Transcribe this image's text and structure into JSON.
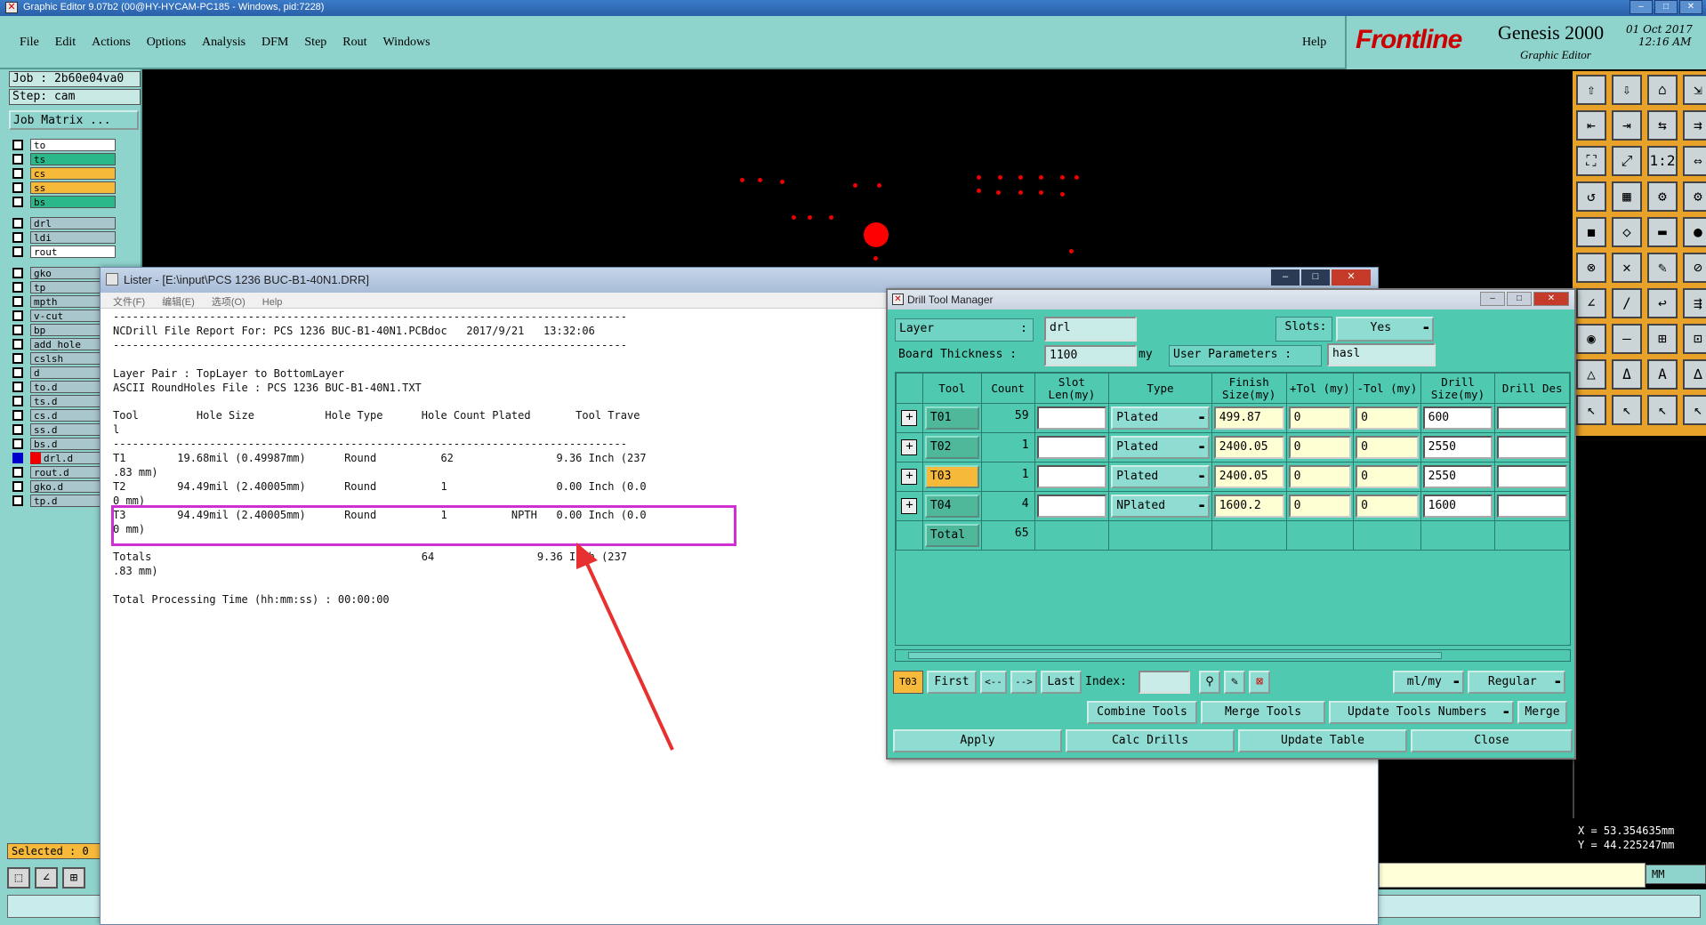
{
  "window": {
    "title": "Graphic Editor 9.07b2 (00@HY-HYCAM-PC185 - Windows, pid:7228)"
  },
  "menu": {
    "items": [
      "File",
      "Edit",
      "Actions",
      "Options",
      "Analysis",
      "DFM",
      "Step",
      "Rout",
      "Windows"
    ],
    "help": "Help"
  },
  "brand": {
    "logo": "Frontline",
    "title": "Genesis 2000",
    "subtitle": "Graphic Editor",
    "date": "01 Oct 2017",
    "time": "12:16 AM"
  },
  "left": {
    "job": "Job : 2b60e04va0",
    "step": "Step: cam",
    "job_matrix": "Job Matrix ...",
    "selected": "Selected : 0",
    "layers_a": [
      {
        "name": "to",
        "color": "#ffffff"
      },
      {
        "name": "ts",
        "color": "#2ab88a"
      },
      {
        "name": "cs",
        "color": "#f7b93a"
      },
      {
        "name": "ss",
        "color": "#f7b93a"
      },
      {
        "name": "bs",
        "color": "#2ab88a"
      }
    ],
    "layers_b": [
      {
        "name": "drl",
        "color": "#a9c6cc"
      },
      {
        "name": "ldi",
        "color": "#a9c6cc"
      },
      {
        "name": "rout",
        "color": "#ffffff"
      }
    ],
    "layers_c": [
      {
        "name": "gko",
        "color": "#a9c6cc"
      },
      {
        "name": "tp",
        "color": "#a9c6cc"
      },
      {
        "name": "mpth",
        "color": "#a9c6cc"
      },
      {
        "name": "v-cut",
        "color": "#a9c6cc"
      },
      {
        "name": "bp",
        "color": "#a9c6cc"
      },
      {
        "name": "add_hole",
        "color": "#a9c6cc"
      },
      {
        "name": "cslsh",
        "color": "#a9c6cc"
      },
      {
        "name": "d",
        "color": "#a9c6cc"
      },
      {
        "name": "to.d",
        "color": "#a9c6cc"
      },
      {
        "name": "ts.d",
        "color": "#a9c6cc"
      },
      {
        "name": "cs.d",
        "color": "#a9c6cc"
      },
      {
        "name": "ss.d",
        "color": "#a9c6cc"
      },
      {
        "name": "bs.d",
        "color": "#a9c6cc"
      },
      {
        "name": "drl.d",
        "color": "#a9c6cc",
        "selected": true
      },
      {
        "name": "rout.d",
        "color": "#a9c6cc"
      },
      {
        "name": "gko.d",
        "color": "#a9c6cc"
      },
      {
        "name": "tp.d",
        "color": "#a9c6cc"
      }
    ]
  },
  "lister": {
    "title": "Lister - [E:\\input\\PCS 1236 BUC-B1-40N1.DRR]",
    "menu": [
      "文件(F)",
      "编辑(E)",
      "选项(O)",
      "Help"
    ],
    "lines": [
      "--------------------------------------------------------------------------------",
      "NCDrill File Report For: PCS 1236 BUC-B1-40N1.PCBdoc   2017/9/21   13:32:06",
      "--------------------------------------------------------------------------------",
      "",
      "Layer Pair : TopLayer to BottomLayer",
      "ASCII RoundHoles File : PCS 1236 BUC-B1-40N1.TXT",
      "",
      "Tool         Hole Size           Hole Type      Hole Count Plated       Tool Trave",
      "l",
      "--------------------------------------------------------------------------------",
      "T1        19.68mil (0.49987mm)      Round          62                9.36 Inch (237",
      ".83 mm)",
      "T2        94.49mil (2.40005mm)      Round          1                 0.00 Inch (0.0",
      "0 mm)",
      "T3        94.49mil (2.40005mm)      Round          1          NPTH   0.00 Inch (0.0",
      "0 mm)",
      "--------------------------------------------------------------------------------",
      "Totals                                          64                9.36 Inch (237",
      ".83 mm)",
      "",
      "Total Processing Time (hh:mm:ss) : 00:00:00"
    ]
  },
  "dtm": {
    "title": "Drill Tool Manager",
    "layer_label": "Layer",
    "layer_value": "drl",
    "slots_label": "Slots:",
    "slots_value": "Yes",
    "thickness_label": "Board Thickness :",
    "thickness_value": "1100",
    "thickness_unit": "my",
    "user_params_label": "User Parameters :",
    "user_params_value": "hasl",
    "headers": [
      "Tool",
      "Count",
      "Slot Len(my)",
      "Type",
      "Finish Size(my)",
      "+Tol (my)",
      "-Tol (my)",
      "Drill Size(my)",
      "Drill Des"
    ],
    "rows": [
      {
        "tool": "T01",
        "count": "59",
        "slot": "",
        "type": "Plated",
        "finish": "499.87",
        "ptol": "0",
        "mtol": "0",
        "drill": "600",
        "des": ""
      },
      {
        "tool": "T02",
        "count": "1",
        "slot": "",
        "type": "Plated",
        "finish": "2400.05",
        "ptol": "0",
        "mtol": "0",
        "drill": "2550",
        "des": ""
      },
      {
        "tool": "T03",
        "count": "1",
        "slot": "",
        "type": "Plated",
        "finish": "2400.05",
        "ptol": "0",
        "mtol": "0",
        "drill": "2550",
        "des": ""
      },
      {
        "tool": "T04",
        "count": "4",
        "slot": "",
        "type": "NPlated",
        "finish": "1600.2",
        "ptol": "0",
        "mtol": "0",
        "drill": "1600",
        "des": ""
      }
    ],
    "total_label": "Total",
    "total_count": "65",
    "nav": {
      "current": "T03",
      "first": "First",
      "prev": "<--",
      "next": "-->",
      "last": "Last",
      "index_label": "Index:",
      "units": "ml/my",
      "mode": "Regular"
    },
    "actions1": [
      "Combine Tools",
      "Merge Tools",
      "Update Tools Numbers",
      "Merge"
    ],
    "actions2": [
      "Apply",
      "Calc Drills",
      "Update Table",
      "Close"
    ]
  },
  "coords": {
    "x": "X = 53.354635mm",
    "y": "Y = 44.225247mm",
    "unit": "MM"
  }
}
